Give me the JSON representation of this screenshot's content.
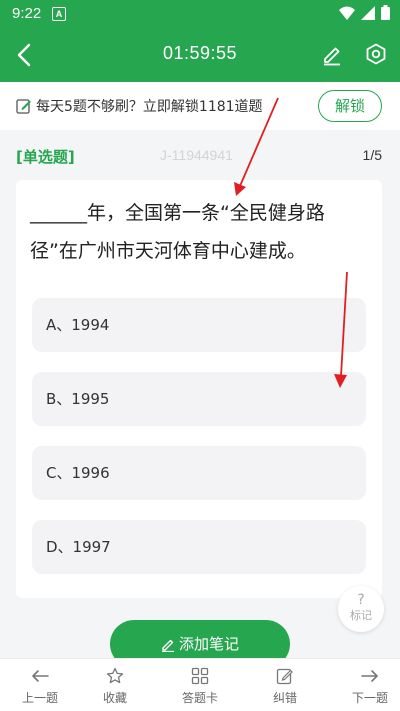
{
  "status_bar": {
    "time": "9:22",
    "notification_letter": "A"
  },
  "header": {
    "timer": "01:59:55"
  },
  "promo": {
    "text": "每天5题不够刷？立即解锁1181道题",
    "button_label": "解锁"
  },
  "question_meta": {
    "type": "[单选题]",
    "id": "J-11944941",
    "progress": "1/5"
  },
  "question": {
    "line1": "______年，全国第一条“全民健身路",
    "line2": "径”在广州市天河体育中心建成。"
  },
  "options": [
    {
      "label": "A、1994"
    },
    {
      "label": "B、1995"
    },
    {
      "label": "C、1996"
    },
    {
      "label": "D、1997"
    }
  ],
  "mark": {
    "icon_glyph": "?",
    "label": "标记"
  },
  "note_button": {
    "label": "添加笔记"
  },
  "bottom_nav": [
    {
      "label": "上一题",
      "icon": "arrow-left-icon"
    },
    {
      "label": "收藏",
      "icon": "star-icon"
    },
    {
      "label": "答题卡",
      "icon": "grid-icon"
    },
    {
      "label": "纠错",
      "icon": "edit-icon"
    },
    {
      "label": "下一题",
      "icon": "arrow-right-icon"
    }
  ],
  "colors": {
    "brand": "#27a650",
    "annotation": "#e02020"
  }
}
